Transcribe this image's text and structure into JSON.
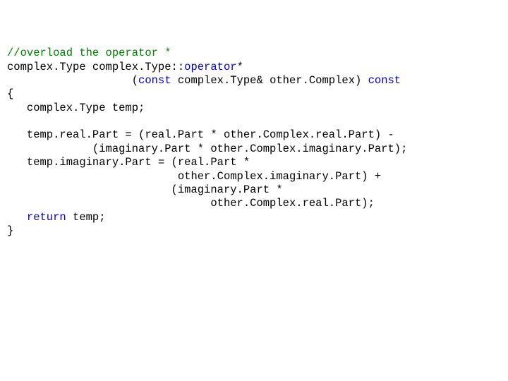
{
  "code": {
    "lines": [
      [
        {
          "t": "//overload the operator *",
          "c": "g"
        }
      ],
      [
        {
          "t": "complex.Type complex.Type::",
          "c": ""
        },
        {
          "t": "operator",
          "c": "k"
        },
        {
          "t": "*",
          "c": ""
        }
      ],
      [
        {
          "t": "                   (",
          "c": ""
        },
        {
          "t": "const",
          "c": "k"
        },
        {
          "t": " complex.Type& other.Complex) ",
          "c": ""
        },
        {
          "t": "const",
          "c": "k"
        }
      ],
      [
        {
          "t": "{",
          "c": ""
        }
      ],
      [
        {
          "t": "   complex.Type temp;",
          "c": ""
        }
      ],
      [
        {
          "t": "",
          "c": ""
        }
      ],
      [
        {
          "t": "   temp.real.Part = (real.Part * other.Complex.real.Part) -",
          "c": ""
        }
      ],
      [
        {
          "t": "             (imaginary.Part * other.Complex.imaginary.Part);",
          "c": ""
        }
      ],
      [
        {
          "t": "   temp.imaginary.Part = (real.Part *",
          "c": ""
        }
      ],
      [
        {
          "t": "                          other.Complex.imaginary.Part) +",
          "c": ""
        }
      ],
      [
        {
          "t": "                         (imaginary.Part *",
          "c": ""
        }
      ],
      [
        {
          "t": "                               other.Complex.real.Part);",
          "c": ""
        }
      ],
      [
        {
          "t": "   ",
          "c": ""
        },
        {
          "t": "return",
          "c": "k"
        },
        {
          "t": " temp;",
          "c": ""
        }
      ],
      [
        {
          "t": "}",
          "c": ""
        }
      ]
    ]
  }
}
